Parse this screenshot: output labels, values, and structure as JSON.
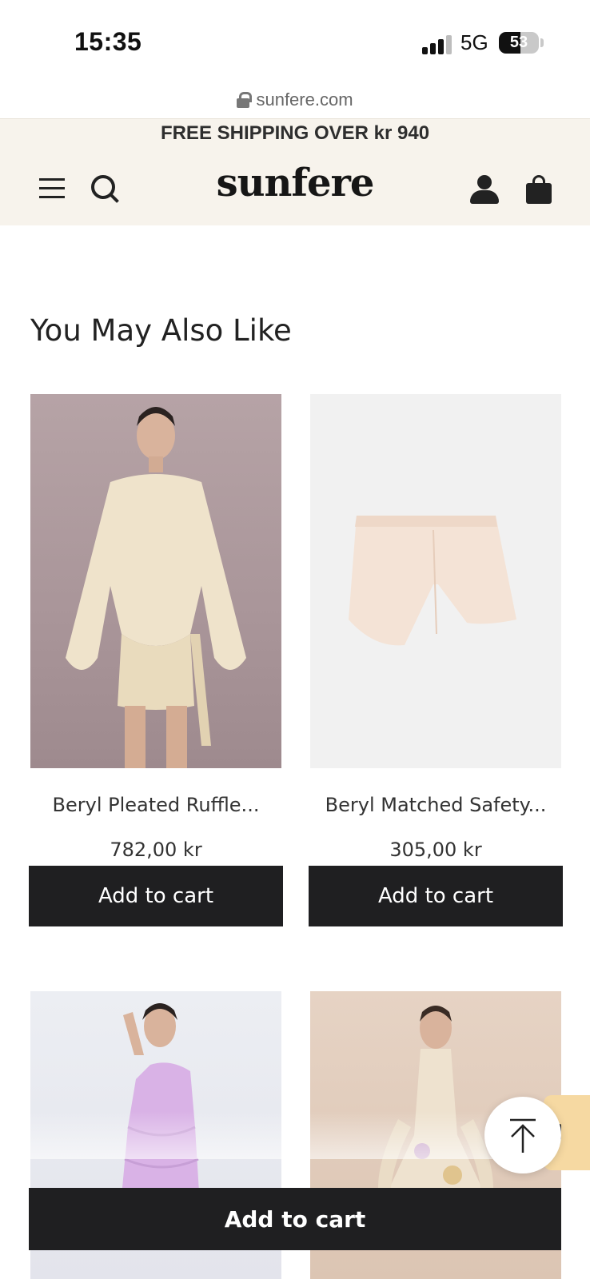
{
  "status_bar": {
    "time": "15:35",
    "network": "5G",
    "battery": "53",
    "battery_level": 0.53
  },
  "browser": {
    "url": "sunfere.com"
  },
  "header": {
    "announcement": "FREE SHIPPING OVER kr 940",
    "logo": "sunfere",
    "icons": [
      "menu-icon",
      "search-icon",
      "user-icon",
      "bag-icon"
    ]
  },
  "section": {
    "title": "You May Also Like"
  },
  "products": [
    {
      "name": "Beryl Pleated Ruffle...",
      "price": "782,00 kr",
      "button": "Add to cart"
    },
    {
      "name": "Beryl Matched Safety...",
      "price": "305,00 kr",
      "button": "Add to cart"
    }
  ],
  "sticky": {
    "button": "Add to cart"
  },
  "colors": {
    "header_bg": "#f7f3ec",
    "button_bg": "#1f1f21",
    "side_tab": "#f6d9a2"
  }
}
